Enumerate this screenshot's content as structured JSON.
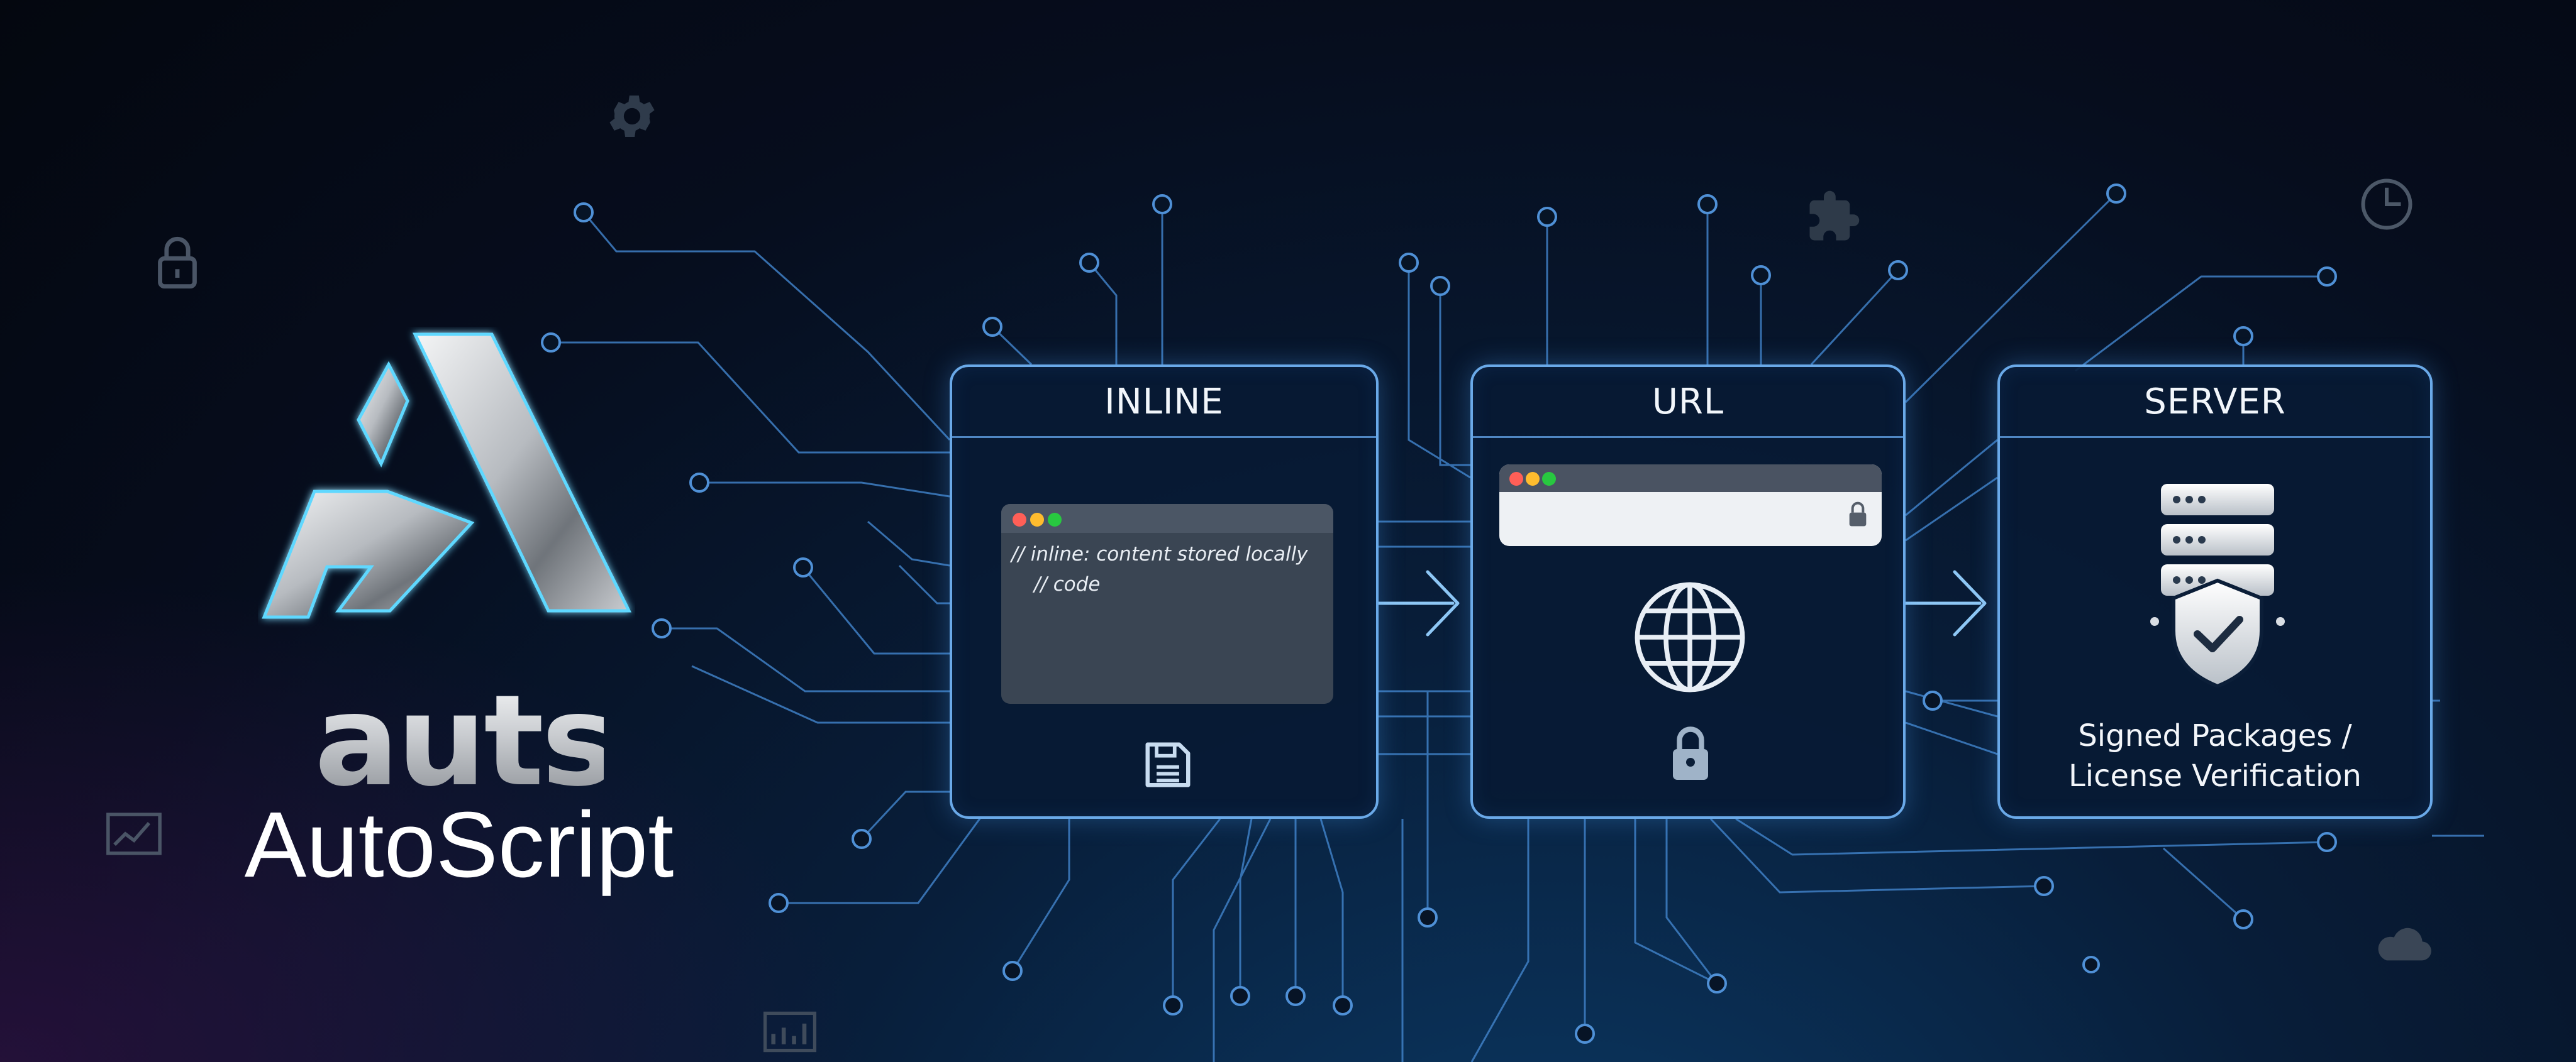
{
  "brand": {
    "logo_text": "auts",
    "name": "AutoScript"
  },
  "panels": [
    {
      "title": "INLINE",
      "code_lines": [
        "// inline: content stored locally",
        "// code"
      ],
      "icon": "floppy-disk-icon"
    },
    {
      "title": "URL",
      "icons": [
        "browser-window-icon",
        "globe-icon",
        "padlock-icon"
      ]
    },
    {
      "title": "SERVER",
      "caption_line1": "Signed Packages /",
      "caption_line2": "License Verification",
      "icons": [
        "server-stack-icon",
        "shield-check-icon"
      ]
    }
  ],
  "colors": {
    "background": "#060d1d",
    "circuit": "#3f7fc4",
    "panel_border": "#6aa9e8",
    "accent_cyan": "#5fd8ff"
  },
  "decorative_icons": [
    "gear-icon",
    "padlock-icon",
    "puzzle-icon",
    "clock-icon",
    "chart-icon",
    "cloud-icon"
  ]
}
